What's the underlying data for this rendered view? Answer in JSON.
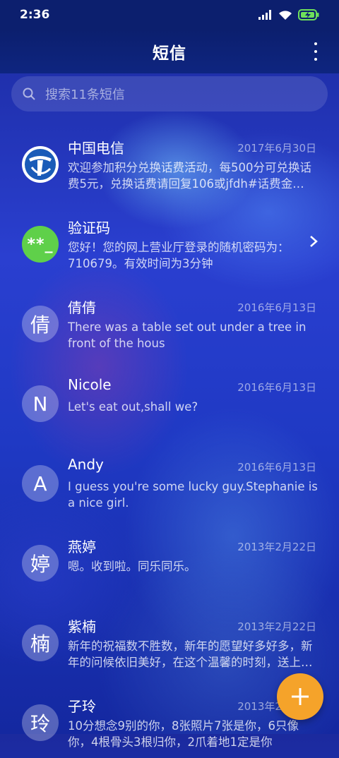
{
  "status_bar": {
    "time": "2:36",
    "icons": [
      "signal-icon",
      "wifi-icon",
      "battery-charging-icon"
    ]
  },
  "header": {
    "title": "短信",
    "more_icon": "more-vert-icon"
  },
  "search": {
    "placeholder": "搜索11条短信",
    "icon": "search-icon"
  },
  "conversations": [
    {
      "avatar_type": "logo",
      "avatar": "",
      "name": "中国电信",
      "date": "2017年6月30日",
      "preview": "欢迎参加积分兑换话费活动，每500分可兑换话费5元，兑换话费请回复106或jfdh#话费金…"
    },
    {
      "avatar_type": "code",
      "avatar": "**_",
      "name": "验证码",
      "date": "",
      "preview": "您好！您的网上营业厅登录的随机密码为：710679。有效时间为3分钟"
    },
    {
      "avatar_type": "letter",
      "avatar": "倩",
      "name": "倩倩",
      "date": "2016年6月13日",
      "preview": "There was a table set out under a tree in front of the hous"
    },
    {
      "avatar_type": "letter",
      "avatar": "N",
      "name": "Nicole",
      "date": "2016年6月13日",
      "preview": "Let's eat out,shall we?"
    },
    {
      "avatar_type": "letter",
      "avatar": "A",
      "name": "Andy",
      "date": "2016年6月13日",
      "preview": "I guess you're some lucky guy.Stephanie is a nice girl."
    },
    {
      "avatar_type": "letter",
      "avatar": "婷",
      "name": "燕婷",
      "date": "2013年2月22日",
      "preview": "嗯。收到啦。同乐同乐。"
    },
    {
      "avatar_type": "letter",
      "avatar": "楠",
      "name": "紫楠",
      "date": "2013年2月22日",
      "preview": "新年的祝福数不胜数，新年的愿望好多好多，新年的问候依旧美好，在这个温馨的时刻，送上…"
    },
    {
      "avatar_type": "letter",
      "avatar": "玲",
      "name": "子玲",
      "date": "2013年2月22日",
      "preview": "10分想念9别的你，8张照片7张是你，6只像你，4根骨头3根归你，2爪着地1定是你"
    }
  ],
  "fab": {
    "icon": "plus-icon"
  }
}
